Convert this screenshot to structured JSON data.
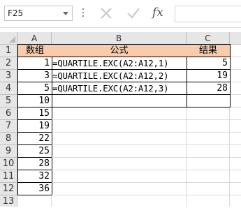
{
  "formula_bar": {
    "name_box": "F25",
    "fx_label": "fx",
    "formula": ""
  },
  "sheet": {
    "columns": [
      "A",
      "B",
      "C"
    ],
    "rows": [
      "1",
      "2",
      "3",
      "4",
      "5",
      "6",
      "7",
      "8",
      "9",
      "10",
      "11",
      "12",
      "13"
    ],
    "header": {
      "a": "数组",
      "b": "公式",
      "c": "结果"
    },
    "col_a_values": [
      "1",
      "3",
      "5",
      "10",
      "15",
      "19",
      "22",
      "25",
      "28",
      "32",
      "36"
    ],
    "formulas": [
      "=QUARTILE.EXC(A2:A12,1)",
      "=QUARTILE.EXC(A2:A12,2)",
      "=QUARTILE.EXC(A2:A12,3)"
    ],
    "results": [
      "5",
      "19",
      "28"
    ],
    "header_fill": "#f8cbad"
  }
}
